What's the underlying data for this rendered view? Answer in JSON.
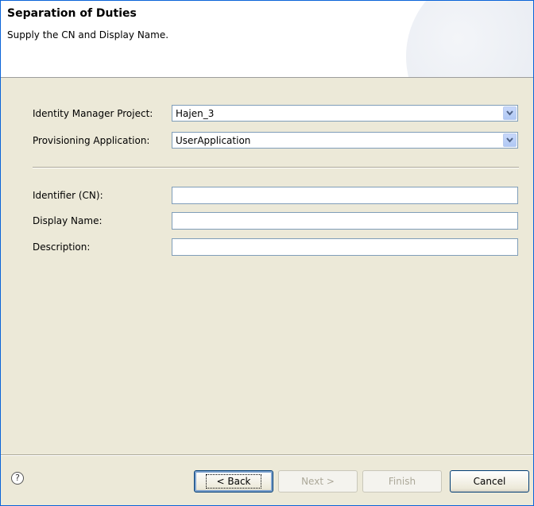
{
  "header": {
    "title": "Separation of Duties",
    "subtitle": "Supply the CN and Display Name."
  },
  "form": {
    "project_label": "Identity Manager Project:",
    "project_value": "Hajen_3",
    "app_label": "Provisioning Application:",
    "app_value": "UserApplication",
    "cn_label": "Identifier (CN):",
    "cn_value": "",
    "display_name_label": "Display Name:",
    "display_name_value": "",
    "description_label": "Description:",
    "description_value": ""
  },
  "footer": {
    "help_icon": "question-mark-icon",
    "help_glyph": "?",
    "back_label": "< Back",
    "next_label": "Next >",
    "finish_label": "Finish",
    "cancel_label": "Cancel"
  }
}
